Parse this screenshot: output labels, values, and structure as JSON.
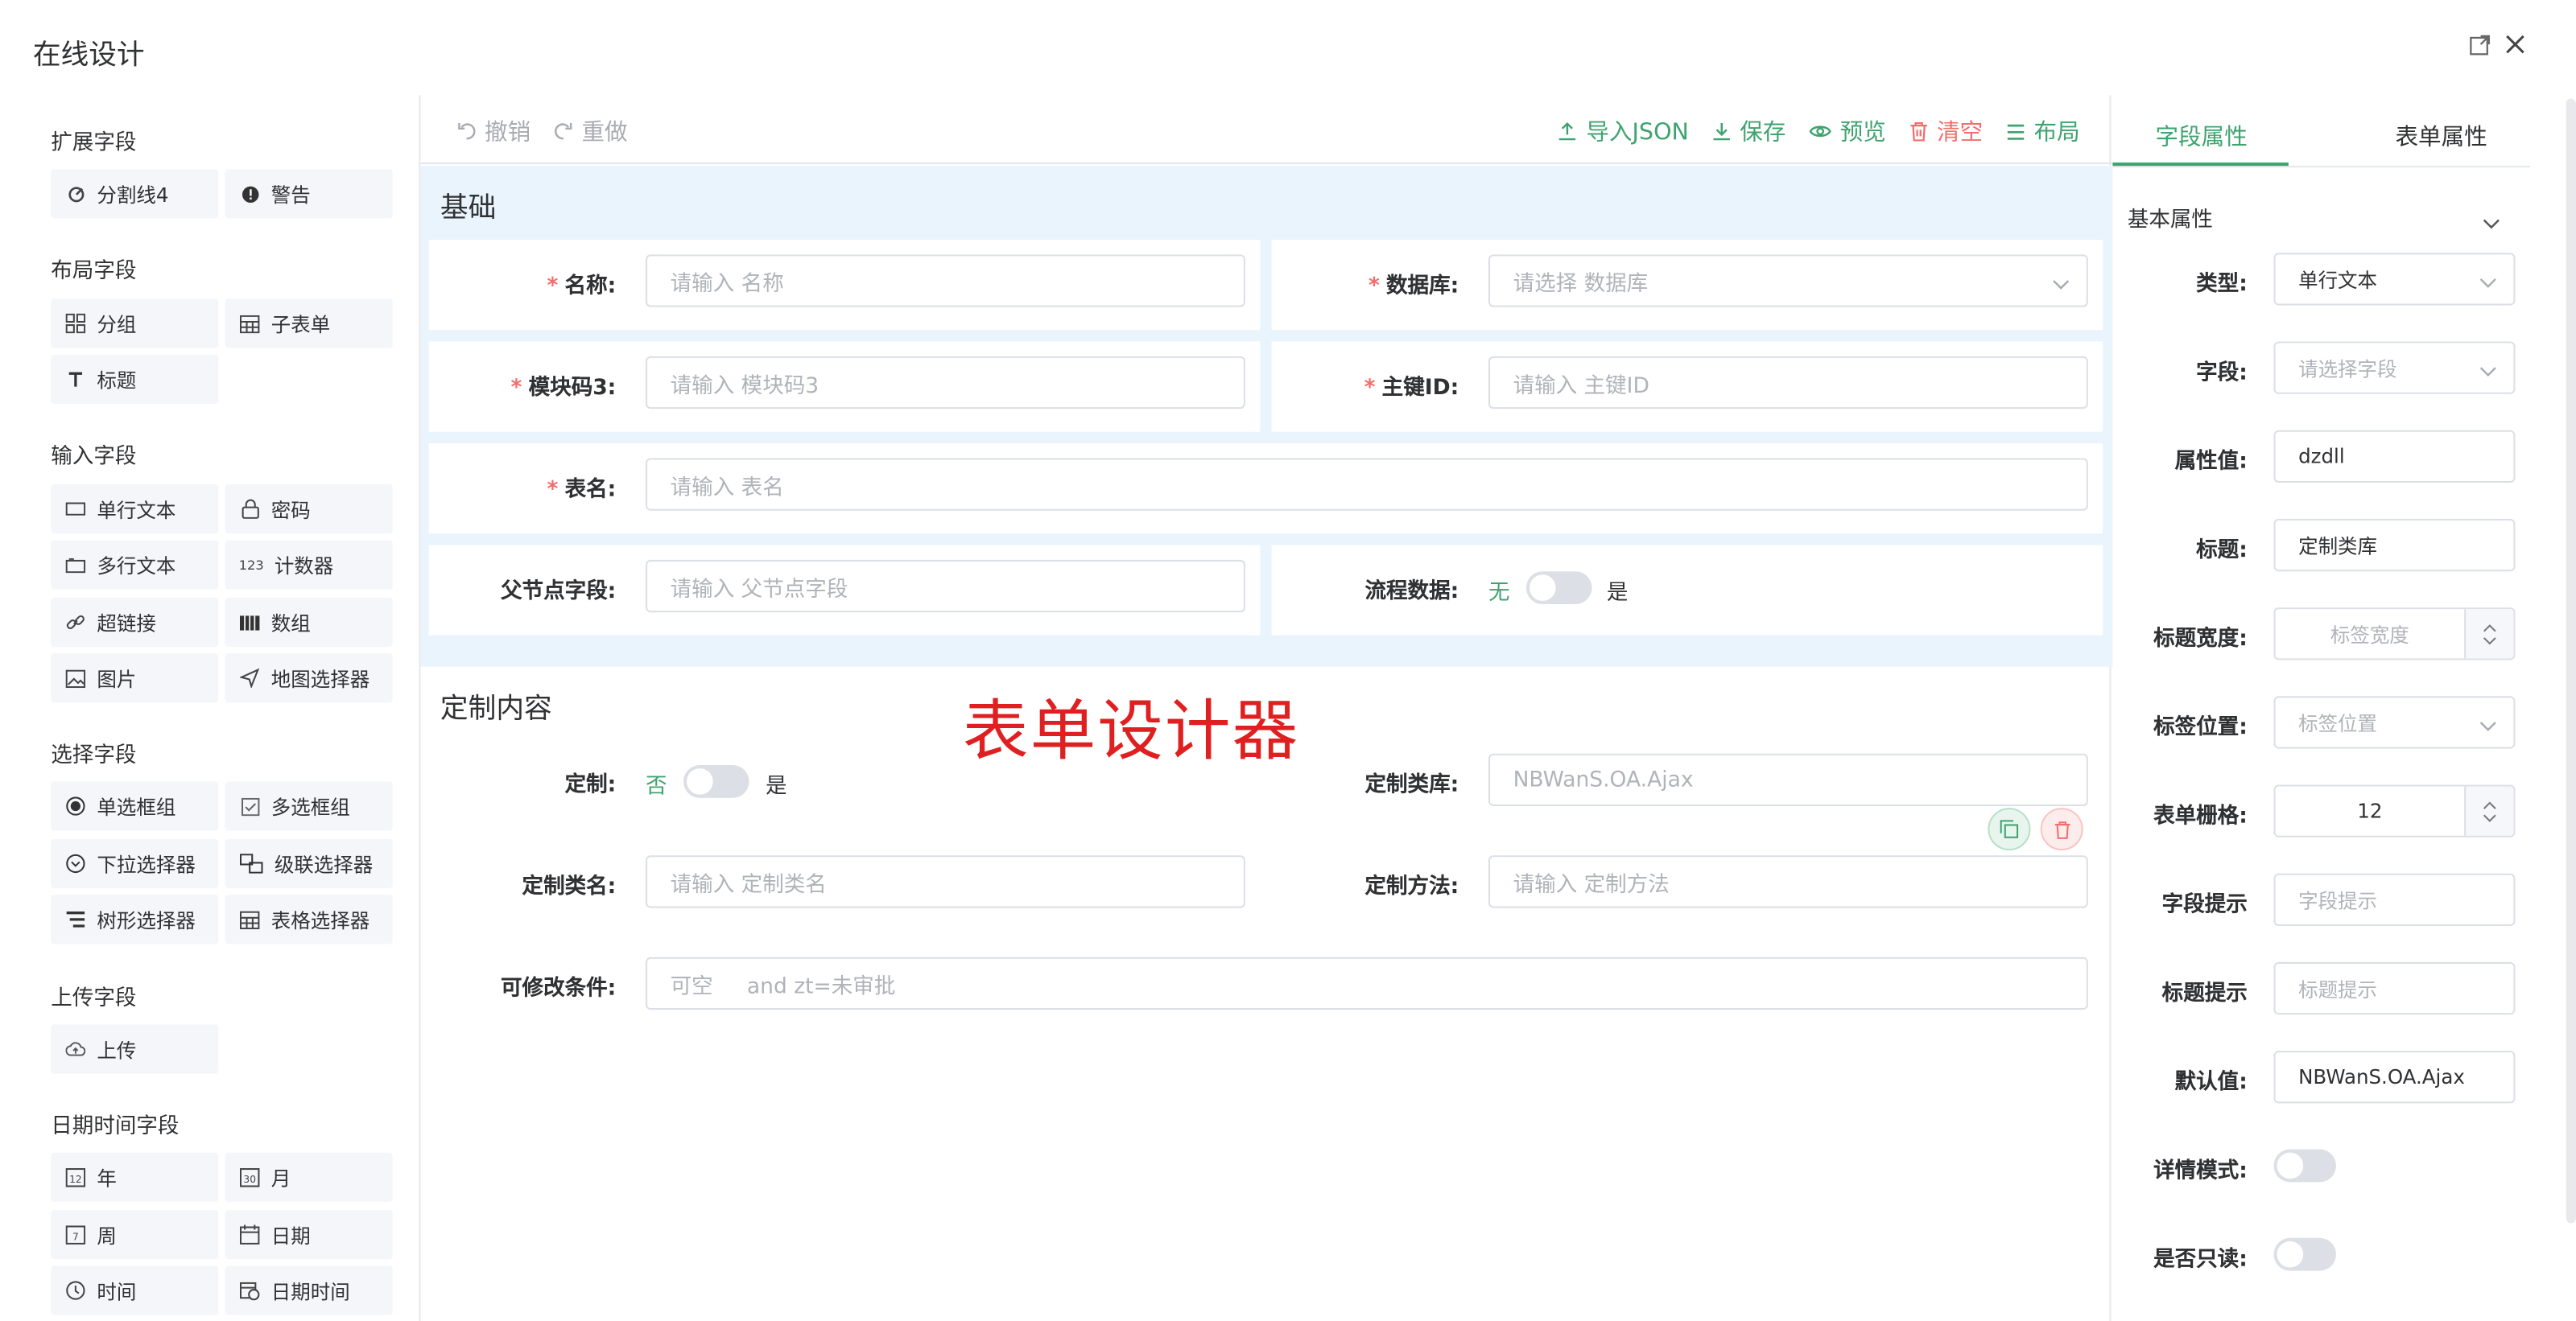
{
  "dialog": {
    "title": "在线设计"
  },
  "left_panel": {
    "groups": [
      {
        "title": "扩展字段",
        "items": [
          {
            "label": "分割线4",
            "icon": "divider-icon"
          },
          {
            "label": "警告",
            "icon": "alert-icon"
          }
        ]
      },
      {
        "title": "布局字段",
        "items": [
          {
            "label": "分组",
            "icon": "grid-icon"
          },
          {
            "label": "子表单",
            "icon": "table-icon"
          },
          {
            "label": "标题",
            "icon": "text-icon"
          }
        ]
      },
      {
        "title": "输入字段",
        "items": [
          {
            "label": "单行文本",
            "icon": "input-icon"
          },
          {
            "label": "密码",
            "icon": "lock-icon"
          },
          {
            "label": "多行文本",
            "icon": "textarea-icon"
          },
          {
            "label": "计数器",
            "icon": "number-icon"
          },
          {
            "label": "超链接",
            "icon": "link-icon"
          },
          {
            "label": "数组",
            "icon": "array-icon"
          },
          {
            "label": "图片",
            "icon": "image-icon"
          },
          {
            "label": "地图选择器",
            "icon": "map-pin-icon"
          }
        ]
      },
      {
        "title": "选择字段",
        "items": [
          {
            "label": "单选框组",
            "icon": "radio-icon"
          },
          {
            "label": "多选框组",
            "icon": "checkbox-icon"
          },
          {
            "label": "下拉选择器",
            "icon": "select-icon"
          },
          {
            "label": "级联选择器",
            "icon": "cascader-icon"
          },
          {
            "label": "树形选择器",
            "icon": "tree-icon"
          },
          {
            "label": "表格选择器",
            "icon": "table-icon"
          }
        ]
      },
      {
        "title": "上传字段",
        "items": [
          {
            "label": "上传",
            "icon": "upload-cloud-icon"
          }
        ]
      },
      {
        "title": "日期时间字段",
        "items": [
          {
            "label": "年",
            "icon": "calendar-year-icon"
          },
          {
            "label": "月",
            "icon": "calendar-month-icon"
          },
          {
            "label": "周",
            "icon": "calendar-week-icon"
          },
          {
            "label": "日期",
            "icon": "calendar-icon"
          },
          {
            "label": "时间",
            "icon": "clock-icon"
          },
          {
            "label": "日期时间",
            "icon": "datetime-icon"
          }
        ]
      }
    ]
  },
  "toolbar": {
    "undo": "撤销",
    "redo": "重做",
    "import_json": "导入JSON",
    "save": "保存",
    "preview": "预览",
    "clear": "清空",
    "layout": "布局"
  },
  "form": {
    "section1_title": "基础",
    "name_label": "名称:",
    "name_ph": "请输入 名称",
    "db_label": "数据库:",
    "db_ph": "请选择 数据库",
    "code_label": "模块码3:",
    "code_ph": "请输入 模块码3",
    "pk_label": "主键ID:",
    "pk_ph": "请输入 主键ID",
    "table_label": "表名:",
    "table_ph": "请输入 表名",
    "parent_label": "父节点字段:",
    "parent_ph": "请输入 父节点字段",
    "flow_label": "流程数据:",
    "flow_off": "无",
    "flow_on": "是",
    "section2_title": "定制内容",
    "custom_label": "定制:",
    "custom_off": "否",
    "custom_on": "是",
    "lib_label": "定制类库:",
    "lib_ph": "NBWanS.OA.Ajax",
    "class_label": "定制类名:",
    "class_ph": "请输入 定制类名",
    "method_label": "定制方法:",
    "method_ph": "请输入 定制方法",
    "cond_label": "可修改条件:",
    "cond_ph": "可空     and zt=未审批"
  },
  "watermark": "表单设计器",
  "right_panel": {
    "tab_field": "字段属性",
    "tab_form": "表单属性",
    "collapse_title": "基本属性",
    "type_label": "类型:",
    "type_val": "单行文本",
    "field_label": "字段:",
    "field_ph": "请选择字段",
    "attr_label": "属性值:",
    "attr_val": "dzdll",
    "title_label": "标题:",
    "title_val": "定制类库",
    "title_width_label": "标题宽度:",
    "title_width_ph": "标签宽度",
    "label_pos_label": "标签位置:",
    "label_pos_ph": "标签位置",
    "grid_label": "表单栅格:",
    "grid_val": "12",
    "hint_label": "字段提示",
    "hint_ph": "字段提示",
    "title_hint_label": "标题提示",
    "title_hint_ph": "标题提示",
    "default_label": "默认值:",
    "default_val": "NBWanS.OA.Ajax",
    "detail_label": "详情模式:",
    "readonly_label": "是否只读:"
  },
  "colors": {
    "accent": "#3fa36f",
    "danger": "#f56c6c",
    "section_bg": "#e9f4fd"
  }
}
